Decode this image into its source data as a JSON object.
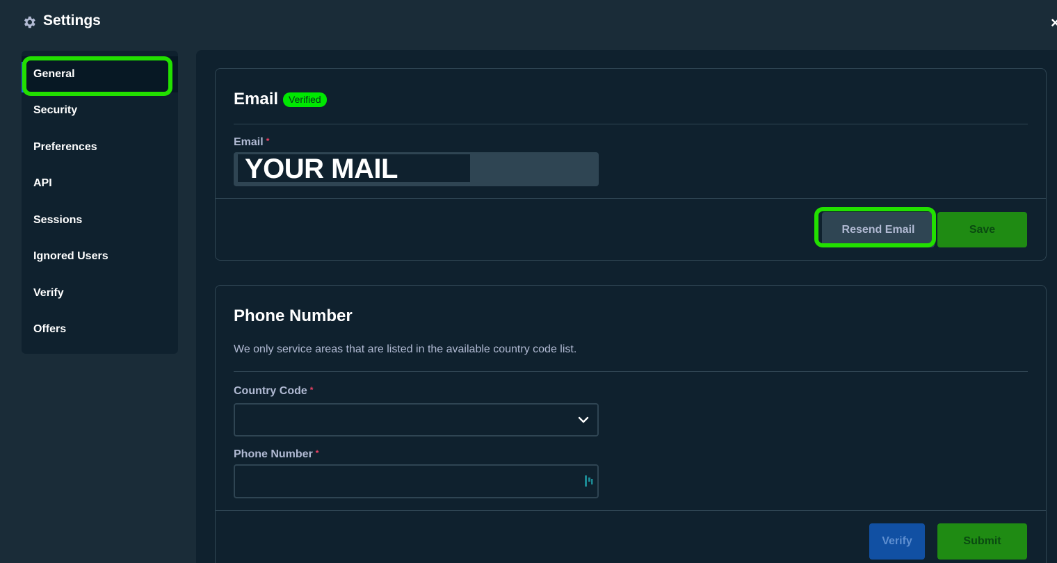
{
  "header": {
    "title": "Settings",
    "close_symbol": "×"
  },
  "sidebar": {
    "items": [
      {
        "label": "General"
      },
      {
        "label": "Security"
      },
      {
        "label": "Preferences"
      },
      {
        "label": "API"
      },
      {
        "label": "Sessions"
      },
      {
        "label": "Ignored Users"
      },
      {
        "label": "Verify"
      },
      {
        "label": "Offers"
      }
    ],
    "active": "General"
  },
  "email_card": {
    "title": "Email",
    "badge": "Verified",
    "field_label": "Email",
    "required_mark": "*",
    "value": "YOUR MAIL",
    "resend_label": "Resend Email",
    "save_label": "Save"
  },
  "phone_card": {
    "title": "Phone Number",
    "description": "We only service areas that are listed in the available country code list.",
    "country_label": "Country Code",
    "country_value": "",
    "phone_label": "Phone Number",
    "phone_value": "",
    "required_mark": "*",
    "verify_label": "Verify",
    "submit_label": "Submit"
  },
  "icons": {
    "header": "gear-icon",
    "select": "chevron-down-icon",
    "phone_field": "password-manager-icon"
  },
  "colors": {
    "page_bg": "#1a2c38",
    "panel_bg": "#0f212e",
    "border": "#2f4553",
    "accent_blue": "#1475e1",
    "badge_green": "#00e701",
    "highlight_green": "#22e000",
    "button_green": "#1f8b13",
    "button_blue": "#1150a3",
    "required_red": "#ed4163"
  }
}
